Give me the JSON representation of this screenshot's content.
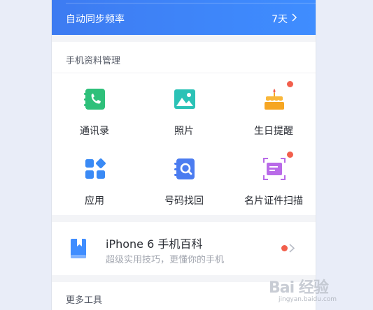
{
  "sync": {
    "label": "自动同步频率",
    "value": "7天"
  },
  "manage": {
    "title": "手机资料管理",
    "tiles": [
      {
        "label": "通讯录",
        "icon": "contacts-icon",
        "color": "#2ec07a",
        "badge": false
      },
      {
        "label": "照片",
        "icon": "photos-icon",
        "color": "#2bc2b6",
        "badge": false
      },
      {
        "label": "生日提醒",
        "icon": "birthday-cake-icon",
        "color": "#f6a623",
        "badge": true
      },
      {
        "label": "应用",
        "icon": "apps-icon",
        "color": "#3a8af5",
        "badge": false
      },
      {
        "label": "号码找回",
        "icon": "number-recovery-icon",
        "color": "#4b7cf0",
        "badge": false
      },
      {
        "label": "名片证件扫描",
        "icon": "card-scan-icon",
        "color": "#b96be8",
        "badge": true
      }
    ]
  },
  "iphone": {
    "title": "iPhone 6 手机百科",
    "subtitle": "超级实用技巧，更懂你的手机",
    "badge": true
  },
  "more": {
    "title": "更多工具"
  },
  "watermark": {
    "text": "Bai 经验",
    "sub": "jingyan.baidu.com"
  },
  "colors": {
    "accent": "#3f8dff",
    "badge": "#f25f4c"
  }
}
